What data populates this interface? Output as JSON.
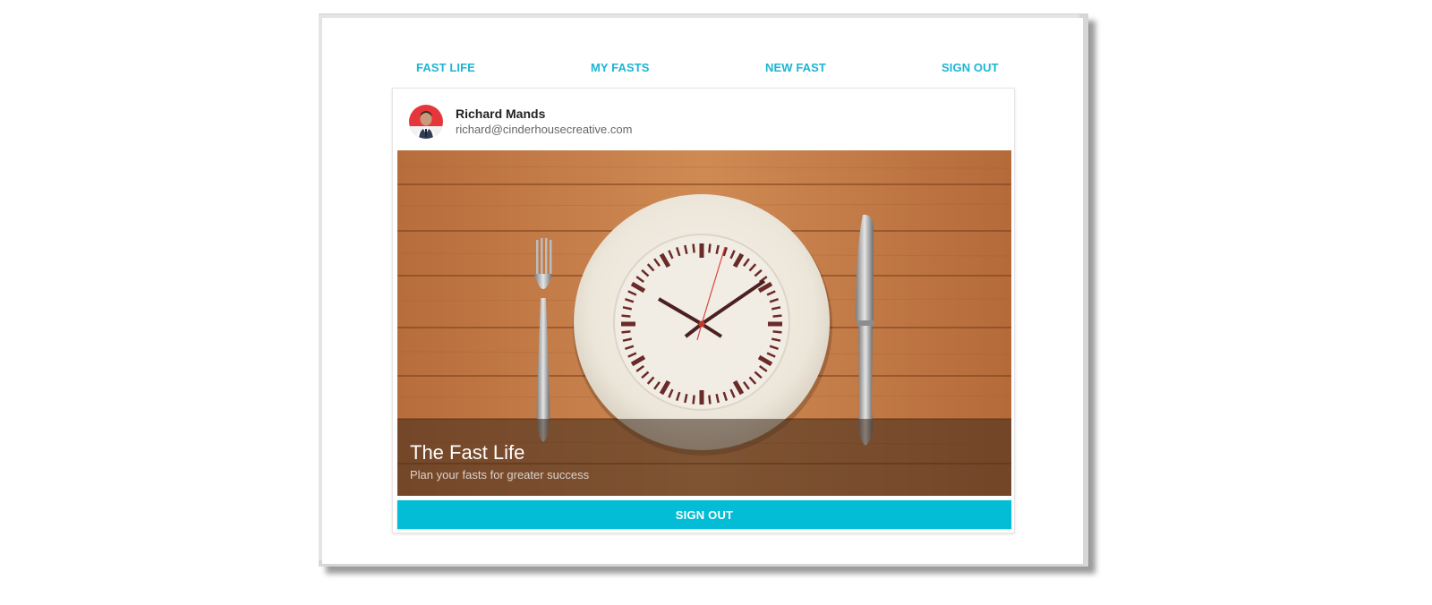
{
  "nav": {
    "items": [
      {
        "label": "FAST LIFE"
      },
      {
        "label": "MY FASTS"
      },
      {
        "label": "NEW FAST"
      },
      {
        "label": "SIGN OUT"
      }
    ]
  },
  "profile": {
    "name": "Richard Mands",
    "email": "richard@cinderhousecreative.com",
    "avatar_icon": "user-photo"
  },
  "hero": {
    "title": "The Fast Life",
    "subtitle": "Plan your fasts for greater success",
    "image_description_icon": "plate-clock-image"
  },
  "actions": {
    "sign_out_label": "SIGN OUT"
  },
  "colors": {
    "accent": "#03bcd6",
    "nav_text": "#1bb6d4",
    "wood": "#c47a45"
  }
}
